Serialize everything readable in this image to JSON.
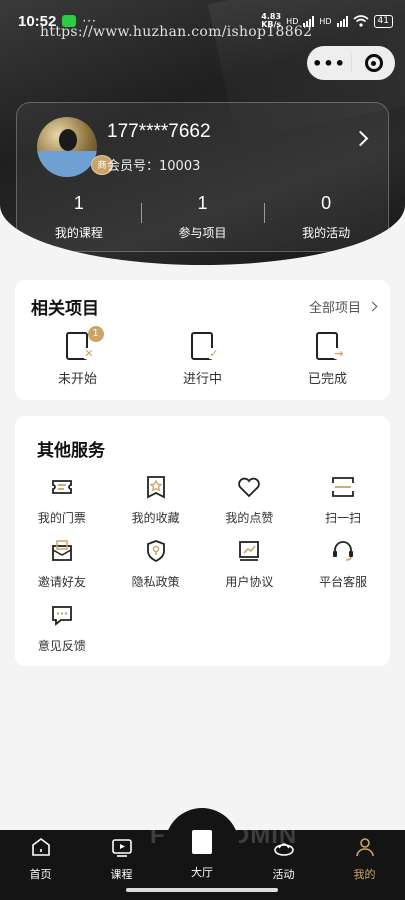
{
  "status_bar": {
    "time": "10:52",
    "more": "···",
    "net_speed": "4.83",
    "net_unit": "KB/s",
    "hd1": "HD",
    "hd2": "HD",
    "battery": "41"
  },
  "watermark": "https://www.huzhan.com/ishop18862",
  "capsule": {
    "more": "•••"
  },
  "profile": {
    "phone": "177****7662",
    "member_label": "会员号：",
    "member_no": "10003",
    "badge": "商",
    "stats": [
      {
        "value": "1",
        "label": "我的课程"
      },
      {
        "value": "1",
        "label": "参与项目"
      },
      {
        "value": "0",
        "label": "我的活动"
      }
    ]
  },
  "projects": {
    "title": "相关项目",
    "all_link": "全部项目",
    "items": [
      {
        "label": "未开始",
        "mark": "✕",
        "notice": "1"
      },
      {
        "label": "进行中",
        "mark": "✓"
      },
      {
        "label": "已完成",
        "mark": "→"
      }
    ]
  },
  "services": {
    "title": "其他服务",
    "items": [
      {
        "label": "我的门票",
        "icon": "ticket-icon"
      },
      {
        "label": "我的收藏",
        "icon": "star-bookmark-icon"
      },
      {
        "label": "我的点赞",
        "icon": "heart-icon"
      },
      {
        "label": "扫一扫",
        "icon": "scan-icon"
      },
      {
        "label": "邀请好友",
        "icon": "invite-mail-icon"
      },
      {
        "label": "隐私政策",
        "icon": "shield-icon"
      },
      {
        "label": "用户协议",
        "icon": "chart-doc-icon"
      },
      {
        "label": "平台客服",
        "icon": "headset-icon"
      },
      {
        "label": "意见反馈",
        "icon": "chat-icon"
      }
    ]
  },
  "tabbar": {
    "items": [
      {
        "label": "首页"
      },
      {
        "label": "课程"
      },
      {
        "label": "大厅"
      },
      {
        "label": "活动"
      },
      {
        "label": "我的"
      }
    ],
    "brand": "FASTADMIN",
    "active_color": "#c9a565"
  }
}
